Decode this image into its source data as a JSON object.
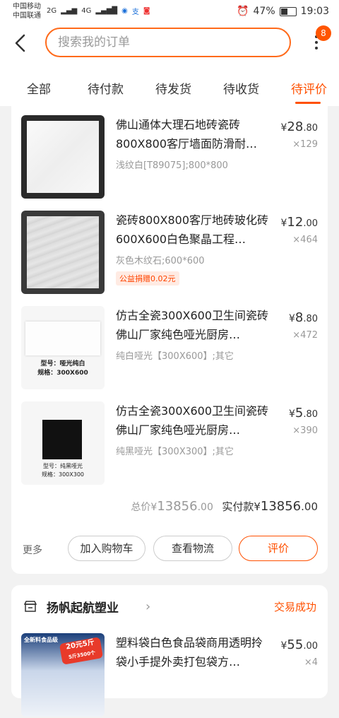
{
  "status_bar": {
    "carrier1": "中国移动",
    "carrier2": "中国联通",
    "net1": "2G",
    "net2": "4G",
    "battery": "47%",
    "time": "19:03"
  },
  "header": {
    "search_placeholder": "搜索我的订单",
    "badge": "8"
  },
  "tabs": [
    {
      "label": "全部"
    },
    {
      "label": "待付款"
    },
    {
      "label": "待发货"
    },
    {
      "label": "待收货"
    },
    {
      "label": "待评价",
      "active": true
    }
  ],
  "order1": {
    "items": [
      {
        "title": "佛山通体大理石地砖瓷砖800X800客厅墙面防滑耐…",
        "spec": "浅纹白[T89075];800*800",
        "price_int": "28",
        "price_dec": ".80",
        "qty": "×129",
        "thumb_style": "white-marble"
      },
      {
        "title": "瓷砖800X800客厅地砖玻化砖600X600白色聚晶工程…",
        "spec": "灰色木纹石;600*600",
        "price_int": "12",
        "price_dec": ".00",
        "qty": "×464",
        "tag": "公益捐赠0.02元",
        "thumb_style": "grey-wood"
      },
      {
        "title": "仿古全瓷300X600卫生间瓷砖佛山厂家纯色哑光厨房…",
        "spec": "纯白哑光【300X600】;其它",
        "price_int": "8",
        "price_dec": ".80",
        "qty": "×472",
        "thumb_label1": "型号：哑光纯白",
        "thumb_label2": "规格：300X600"
      },
      {
        "title": "仿古全瓷300X600卫生间瓷砖佛山厂家纯色哑光厨房…",
        "spec": "纯黑哑光【300X300】;其它",
        "price_int": "5",
        "price_dec": ".80",
        "qty": "×390",
        "thumb_label1": "型号：纯黑哑光",
        "thumb_label2": "规格：300X300"
      }
    ],
    "total_label": "总价",
    "total_int": "13856",
    "total_dec": ".00",
    "paid_label": "实付款",
    "paid_int": "13856",
    "paid_dec": ".00",
    "more_label": "更多",
    "btn_cart": "加入购物车",
    "btn_logistics": "查看物流",
    "btn_review": "评价"
  },
  "order2": {
    "shop_name": "扬帆起航塑业",
    "status": "交易成功",
    "item": {
      "title": "塑料袋白色食品袋商用透明拎袋小手提外卖打包袋方…",
      "price_int": "55",
      "price_dec": ".00",
      "qty": "×4",
      "thumb_label": "全新料食品级",
      "thumb_promo1": "20元5斤",
      "thumb_promo2": "5斤3500个"
    }
  },
  "currency": "¥",
  "colors": {
    "accent": "#ff5000",
    "background": "#f2f2f2"
  }
}
